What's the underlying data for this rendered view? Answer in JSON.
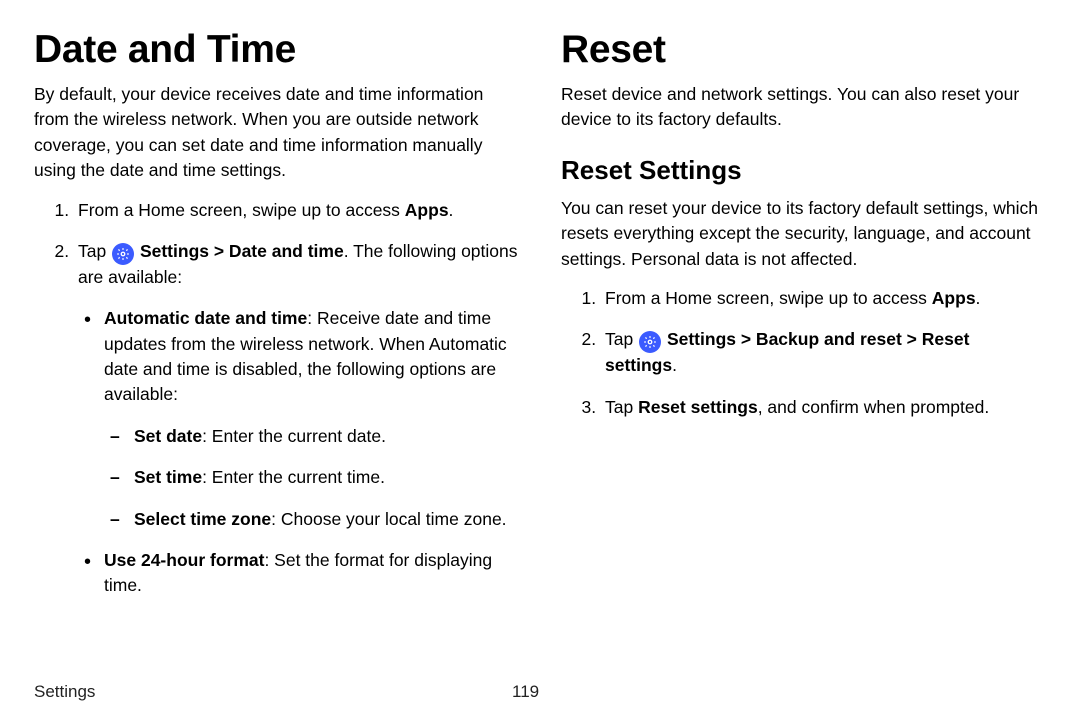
{
  "left": {
    "title": "Date and Time",
    "intro": "By default, your device receives date and time information from the wireless network. When you are outside network coverage, you can set date and time information manually using the date and time settings.",
    "step1_pre": "From a Home screen, swipe up to access ",
    "step1_bold": "Apps",
    "step1_post": ".",
    "step2_pre": "Tap ",
    "step2_bold": "Settings > Date and time",
    "step2_post": ". The following options are available:",
    "bullet1_bold": "Automatic date and time",
    "bullet1_rest": ": Receive date and time updates from the wireless network. When Automatic date and time is disabled, the following options are available:",
    "dash1_bold": "Set date",
    "dash1_rest": ": Enter the current date.",
    "dash2_bold": "Set time",
    "dash2_rest": ": Enter the current time.",
    "dash3_bold": "Select time zone",
    "dash3_rest": ": Choose your local time zone.",
    "bullet2_bold": "Use 24-hour format",
    "bullet2_rest": ": Set the format for displaying time."
  },
  "right": {
    "title": "Reset",
    "intro": "Reset device and network settings. You can also reset your device to its factory defaults.",
    "sub": "Reset Settings",
    "subintro": "You can reset your device to its factory default settings, which resets everything except the security, language, and account settings. Personal data is not affected.",
    "step1_pre": "From a Home screen, swipe up to access ",
    "step1_bold": "Apps",
    "step1_post": ".",
    "step2_pre": "Tap ",
    "step2_bold1": "Settings > Backup and reset > Reset settings",
    "step2_post": ".",
    "step3_pre": "Tap ",
    "step3_bold": "Reset settings",
    "step3_post": ", and confirm when prompted."
  },
  "footer": {
    "section": "Settings",
    "page": "119"
  }
}
